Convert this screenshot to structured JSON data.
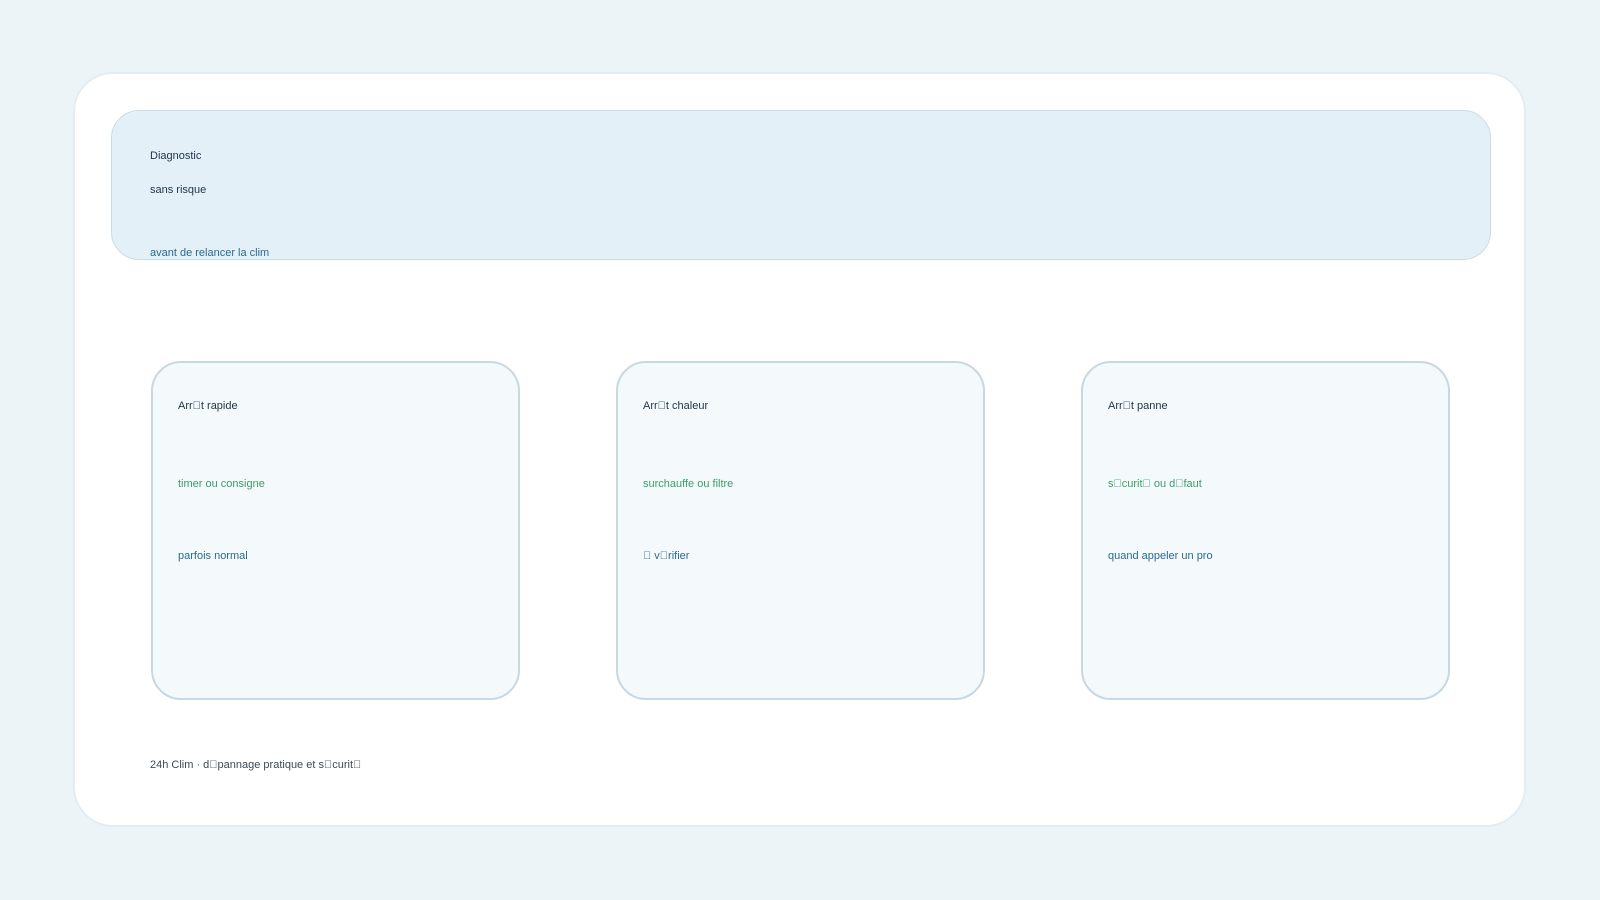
{
  "hero": {
    "title": "Diagnostic",
    "subtitle": "sans risque",
    "note": "avant de relancer la clim"
  },
  "cards": [
    {
      "title": "Arr\u0000t rapide",
      "cause": "timer ou consigne",
      "hint": "parfois normal"
    },
    {
      "title": "Arr\u0000t chaleur",
      "cause": "surchauffe ou filtre",
      "hint": "\u0000 v\u0000rifier"
    },
    {
      "title": "Arr\u0000t panne",
      "cause": "s\u0000curit\u0000 ou d\u0000faut",
      "hint": "quand appeler un pro"
    }
  ],
  "footer": {
    "text": "24h Clim · d\u0000pannage pratique et s\u0000curit\u0000"
  },
  "colors": {
    "background": "#ecf4f8",
    "hero_fill": "#e4f0f8",
    "card_fill": "#f4f9fc",
    "border": "#c6d9e3",
    "title_text": "#1d3446",
    "cause_text": "#3f9b66",
    "hint_text": "#2c6a8e"
  }
}
